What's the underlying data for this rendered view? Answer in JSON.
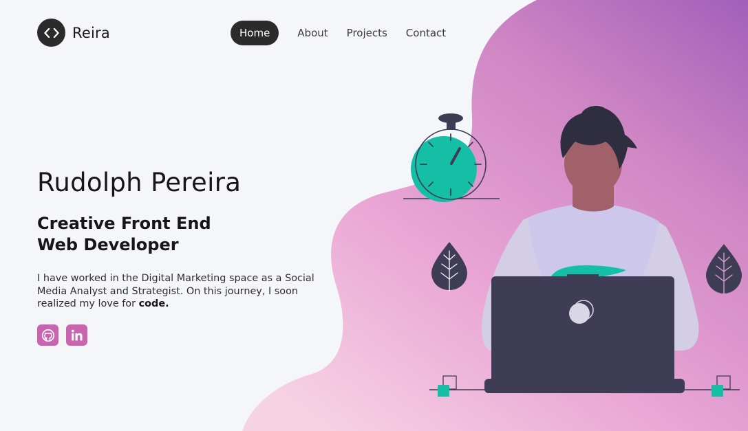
{
  "brand": {
    "name": "Reira",
    "logo_glyph": "<>",
    "logo_icon": "code-brackets-icon"
  },
  "nav": {
    "items": [
      {
        "label": "Home",
        "active": true
      },
      {
        "label": "About",
        "active": false
      },
      {
        "label": "Projects",
        "active": false
      },
      {
        "label": "Contact",
        "active": false
      }
    ]
  },
  "hero": {
    "name": "Rudolph Pereira",
    "role_line1": "Creative Front End",
    "role_line2": "Web Developer",
    "description_prefix": "I have worked in the Digital Marketing space as a Social Media Analyst and Strategist. On this journey, I soon realized my love for ",
    "description_emphasis": "code."
  },
  "socials": {
    "items": [
      {
        "name": "github",
        "icon": "github-icon"
      },
      {
        "name": "linkedin",
        "icon": "linkedin-icon"
      }
    ]
  },
  "colors": {
    "background": "#f5f6fa",
    "dark": "#2b2b2b",
    "accent_teal": "#14bfa6",
    "blob_light": "#f3c4da",
    "blob_pink": "#e6a0d2",
    "blob_purple": "#a460b9",
    "social_pink": "#c964b0",
    "laptop": "#3f3d56"
  }
}
